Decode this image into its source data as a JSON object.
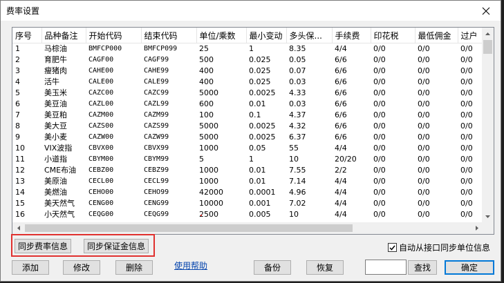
{
  "window": {
    "title": "费率设置"
  },
  "table": {
    "columns": [
      "序号",
      "品种备注",
      "开始代码",
      "结束代码",
      "单位/乘数",
      "最小变动",
      "多头保...",
      "手续费",
      "印花税",
      "最低佣金",
      "过户"
    ],
    "rows": [
      [
        "1",
        "马棕油",
        "BMFCP000",
        "BMFCP099",
        "25",
        "1",
        "8.35",
        "4/4",
        "0/0",
        "0/0",
        "0/0"
      ],
      [
        "2",
        "育肥牛",
        "CAGF00",
        "CAGF99",
        "500",
        "0.025",
        "0.05",
        "6/6",
        "0/0",
        "0/0",
        "0/0"
      ],
      [
        "3",
        "瘦猪肉",
        "CAHE00",
        "CAHE99",
        "400",
        "0.025",
        "0.07",
        "6/6",
        "0/0",
        "0/0",
        "0/0"
      ],
      [
        "4",
        "活牛",
        "CALE00",
        "CALE99",
        "400",
        "0.025",
        "0.03",
        "6/6",
        "0/0",
        "0/0",
        "0/0"
      ],
      [
        "5",
        "美玉米",
        "CAZC00",
        "CAZC99",
        "5000",
        "0.0025",
        "4.33",
        "6/6",
        "0/0",
        "0/0",
        "0/0"
      ],
      [
        "6",
        "美豆油",
        "CAZL00",
        "CAZL99",
        "600",
        "0.01",
        "0.03",
        "6/6",
        "0/0",
        "0/0",
        "0/0"
      ],
      [
        "7",
        "美豆粕",
        "CAZM00",
        "CAZM99",
        "100",
        "0.1",
        "4.37",
        "6/6",
        "0/0",
        "0/0",
        "0/0"
      ],
      [
        "8",
        "美大豆",
        "CAZS00",
        "CAZS99",
        "5000",
        "0.0025",
        "4.32",
        "6/6",
        "0/0",
        "0/0",
        "0/0"
      ],
      [
        "9",
        "美小麦",
        "CAZW00",
        "CAZW99",
        "5000",
        "0.0025",
        "6.37",
        "6/6",
        "0/0",
        "0/0",
        "0/0"
      ],
      [
        "10",
        "VIX波指",
        "CBVX00",
        "CBVX99",
        "1000",
        "0.05",
        "55",
        "4/4",
        "0/0",
        "0/0",
        "0/0"
      ],
      [
        "11",
        "小道指",
        "CBYM00",
        "CBYM99",
        "5",
        "1",
        "10",
        "20/20",
        "0/0",
        "0/0",
        "0/0"
      ],
      [
        "12",
        "CME布油",
        "CEBZ00",
        "CEBZ99",
        "1000",
        "0.01",
        "7.55",
        "2/2",
        "0/0",
        "0/0",
        "0/0"
      ],
      [
        "13",
        "美原油",
        "CECL00",
        "CECL99",
        "1000",
        "0.01",
        "7.14",
        "4/4",
        "0/0",
        "0/0",
        "0/0"
      ],
      [
        "14",
        "美燃油",
        "CEHO00",
        "CEHO99",
        "42000",
        "0.0001",
        "4.96",
        "4/4",
        "0/0",
        "0/0",
        "0/0"
      ],
      [
        "15",
        "美天然气",
        "CENG00",
        "CENG99",
        "10000",
        "0.001",
        "7.02",
        "4/4",
        "0/0",
        "0/0",
        "0/0"
      ],
      [
        "16",
        "小天然气",
        "CEQG00",
        "CEQG99",
        "2500",
        "0.005",
        "10",
        "4/4",
        "0/0",
        "0/0",
        "0/0"
      ]
    ]
  },
  "buttons": {
    "sync_fee": "同步费率信息",
    "sync_margin": "同步保证金信息",
    "add": "添加",
    "modify": "修改",
    "delete": "删除",
    "backup": "备份",
    "restore": "恢复",
    "search": "查找",
    "ok": "确定"
  },
  "help_link": "使用帮助",
  "auto_sync": {
    "label": "自动从接口同步单位信息",
    "checked": true
  },
  "search_input": {
    "value": ""
  },
  "colors": {
    "highlight": "#e0302e",
    "accent": "#0078d7",
    "link": "#0645ad"
  }
}
